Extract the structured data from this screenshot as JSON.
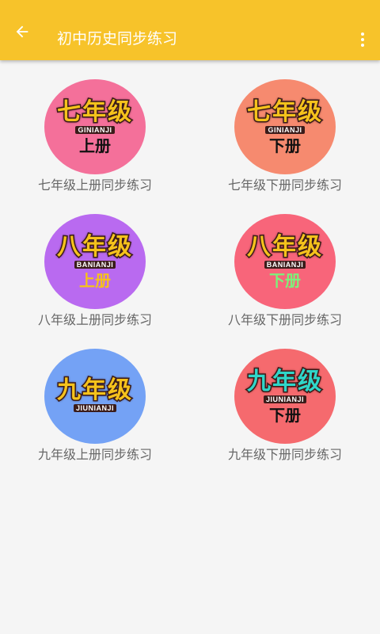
{
  "appbar": {
    "title": "初中历史同步练习",
    "back_icon": "arrow-left-icon",
    "menu_icon": "more-vert-icon"
  },
  "colors": {
    "appbar": "#f7c32a",
    "background": "#f5f5f5"
  },
  "grades": [
    {
      "label": "七年级上册同步练习",
      "badge_grade": "七年级",
      "badge_pinyin": "GINIANJI",
      "badge_volume": "上册",
      "circle_color": "#f4709a",
      "grade_color": "#f5c21c",
      "volume_color": "#111111"
    },
    {
      "label": "七年级下册同步练习",
      "badge_grade": "七年级",
      "badge_pinyin": "GINIANJI",
      "badge_volume": "下册",
      "circle_color": "#f68a6f",
      "grade_color": "#f5c21c",
      "volume_color": "#111111"
    },
    {
      "label": "八年级上册同步练习",
      "badge_grade": "八年级",
      "badge_pinyin": "BANIANJI",
      "badge_volume": "上册",
      "circle_color": "#b96af0",
      "grade_color": "#f5c21c",
      "volume_color": "#f5c21c"
    },
    {
      "label": "八年级下册同步练习",
      "badge_grade": "八年级",
      "badge_pinyin": "BANIANJI",
      "badge_volume": "下册",
      "circle_color": "#f8657a",
      "grade_color": "#f5c21c",
      "volume_color": "#7cf27a"
    },
    {
      "label": "九年级上册同步练习",
      "badge_grade": "九年级",
      "badge_pinyin": "JIUNIANJI",
      "badge_volume": "",
      "circle_color": "#74a2f5",
      "grade_color": "#f5c21c",
      "volume_color": "#111111"
    },
    {
      "label": "九年级下册同步练习",
      "badge_grade": "九年级",
      "badge_pinyin": "JIUNIANJI",
      "badge_volume": "下册",
      "circle_color": "#f56a6e",
      "grade_color": "#2fd6c9",
      "volume_color": "#111111"
    }
  ]
}
